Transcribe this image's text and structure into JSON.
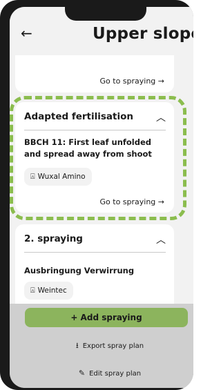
{
  "header": {
    "title": "Upper slope",
    "back_icon": "arrow-left-icon"
  },
  "cards": [
    {
      "goto_label": "Go to spraying →"
    },
    {
      "title": "Adapted fertilisation",
      "stage": "BBCH 11: First leaf unfolded and spread away from shoot",
      "product": "Wuxal Amino",
      "goto_label": "Go to spraying →",
      "highlight_color": "#8bbd4e"
    },
    {
      "title": "2. spraying",
      "stage": "Ausbringung Verwirrung",
      "product": "Weintec"
    }
  ],
  "actions": {
    "add_label": "+ Add spraying",
    "export_label": "Export spray plan",
    "edit_label": "Edit spray plan",
    "add_color": "#8cb45d"
  }
}
